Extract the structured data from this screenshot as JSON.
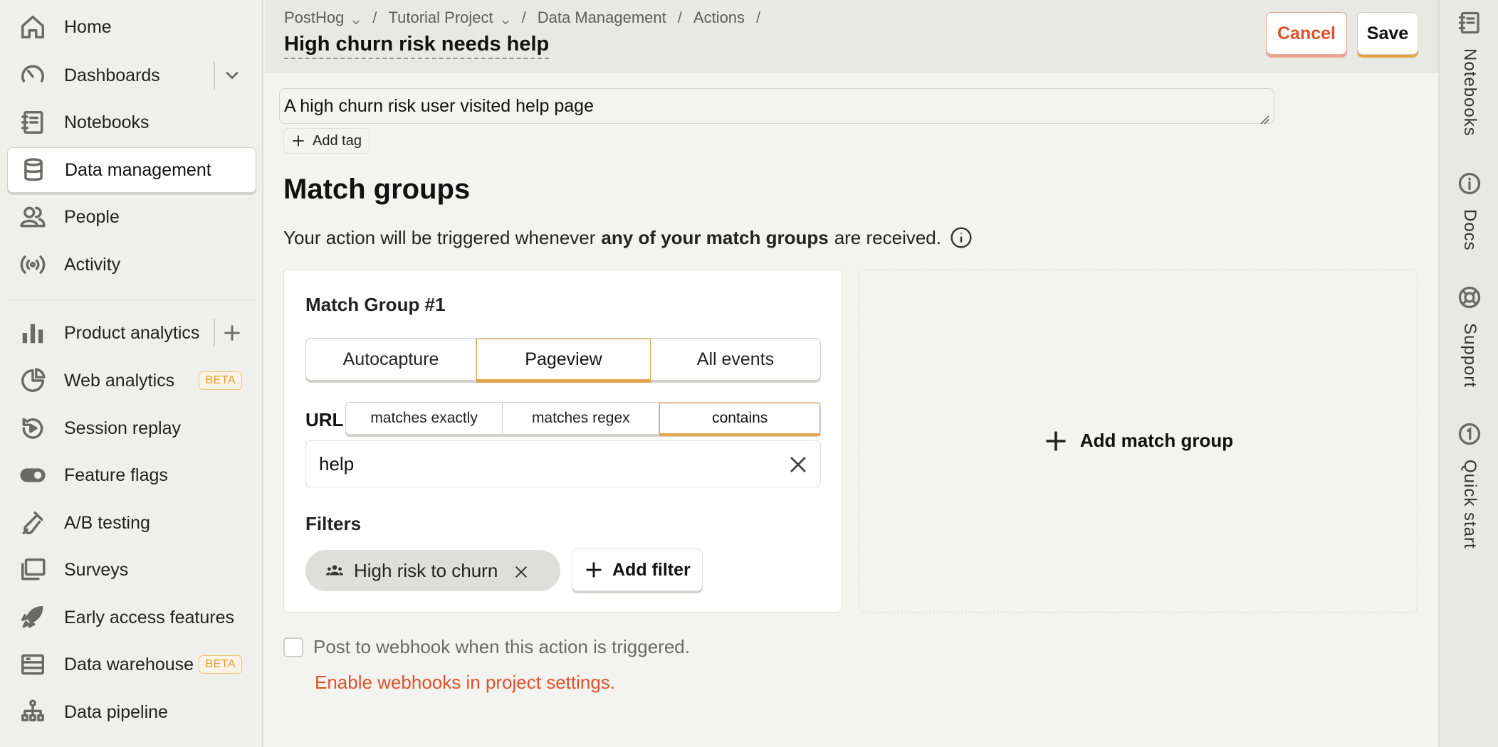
{
  "sidebar": {
    "items": [
      {
        "label": "Home",
        "icon": "home-icon"
      },
      {
        "label": "Dashboards",
        "icon": "dashboard-icon"
      },
      {
        "label": "Notebooks",
        "icon": "notebook-icon"
      },
      {
        "label": "Data management",
        "icon": "database-icon",
        "active": true
      },
      {
        "label": "People",
        "icon": "people-icon"
      },
      {
        "label": "Activity",
        "icon": "activity-icon"
      },
      {
        "label": "Product analytics",
        "icon": "bar-chart-icon"
      },
      {
        "label": "Web analytics",
        "icon": "pie-chart-icon",
        "badge": "BETA"
      },
      {
        "label": "Session replay",
        "icon": "replay-icon"
      },
      {
        "label": "Feature flags",
        "icon": "toggle-icon"
      },
      {
        "label": "A/B testing",
        "icon": "flask-icon"
      },
      {
        "label": "Surveys",
        "icon": "survey-icon"
      },
      {
        "label": "Early access features",
        "icon": "rocket-icon"
      },
      {
        "label": "Data warehouse",
        "icon": "warehouse-icon",
        "badge": "BETA"
      },
      {
        "label": "Data pipeline",
        "icon": "pipeline-icon"
      }
    ]
  },
  "breadcrumbs": [
    {
      "label": "PostHog",
      "dropdown": true
    },
    {
      "label": "Tutorial Project",
      "dropdown": true
    },
    {
      "label": "Data Management",
      "dropdown": false
    },
    {
      "label": "Actions",
      "dropdown": false
    }
  ],
  "page_title": "High churn risk needs help",
  "actions": {
    "cancel": "Cancel",
    "save": "Save"
  },
  "description": "A high churn risk user visited help page",
  "add_tag": "Add tag",
  "match_groups": {
    "heading": "Match groups",
    "subtitle_pre": "Your action will be triggered whenever",
    "subtitle_bold": "any of your match groups",
    "subtitle_post": "are received.",
    "group": {
      "title": "Match Group #1",
      "tabs": [
        "Autocapture",
        "Pageview",
        "All events"
      ],
      "active_tab": "Pageview",
      "url_label": "URL",
      "url_modes": [
        "matches exactly",
        "matches regex",
        "contains"
      ],
      "active_url_mode": "contains",
      "url_value": "help",
      "filters_label": "Filters",
      "filter_chip": "High risk to churn",
      "add_filter": "Add filter"
    },
    "add_group": "Add match group"
  },
  "webhook": {
    "checkbox_label": "Post to webhook when this action is triggered.",
    "checked": false,
    "link": "Enable webhooks in project settings."
  },
  "rightbar": {
    "items": [
      {
        "label": "Notebooks",
        "icon": "notebook-icon"
      },
      {
        "label": "Docs",
        "icon": "info-icon"
      },
      {
        "label": "Support",
        "icon": "lifebuoy-icon"
      },
      {
        "label": "Quick start",
        "icon": "quickstart-icon"
      }
    ]
  },
  "colors": {
    "accent_orange": "#e2a74d",
    "danger": "#e0512a",
    "beta": "#e99b2b"
  }
}
